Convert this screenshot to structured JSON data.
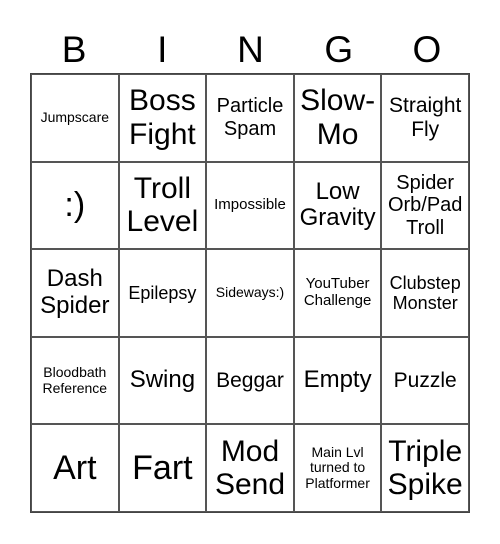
{
  "header": [
    "B",
    "I",
    "N",
    "G",
    "O"
  ],
  "cells": [
    "Jumpscare",
    "Boss Fight",
    "Particle Spam",
    "Slow-Mo",
    "Straight Fly",
    ":)",
    "Troll Level",
    "Impossible",
    "Low Gravity",
    "Spider Orb/Pad Troll",
    "Dash Spider",
    "Epilepsy",
    "Sideways:)",
    "YouTuber Challenge",
    "Clubstep Monster",
    "Bloodbath Reference",
    "Swing",
    "Beggar",
    "Empty",
    "Puzzle",
    "Art",
    "Fart",
    "Mod Send",
    "Main Lvl turned to Platformer",
    "Triple Spike"
  ]
}
